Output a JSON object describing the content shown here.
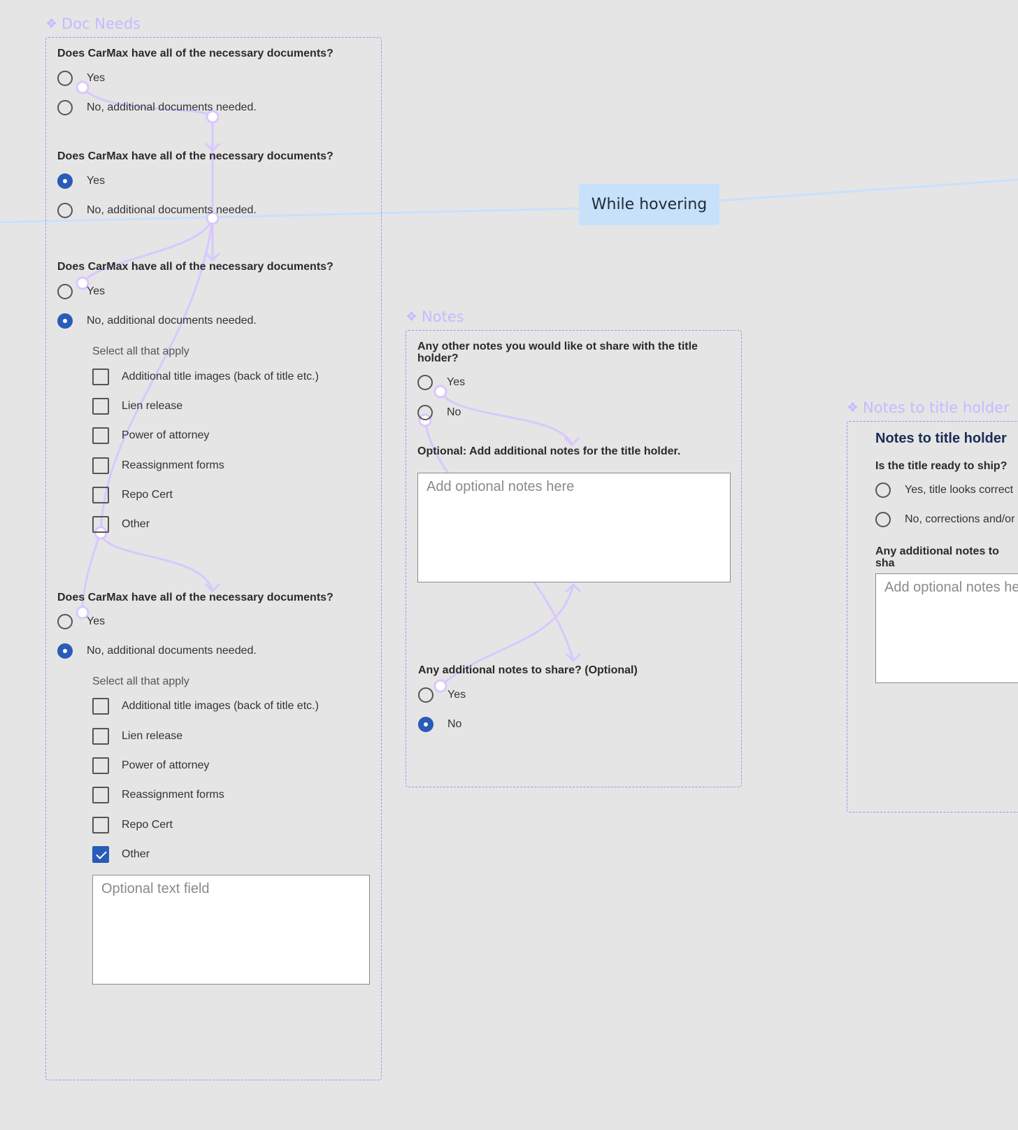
{
  "frames": {
    "doc_needs": {
      "label": "Doc Needs"
    },
    "notes": {
      "label": "Notes"
    },
    "notes_title_holder": {
      "label": "Notes to title holder"
    }
  },
  "hover_tag": "While hovering",
  "doc_needs": {
    "question": "Does CarMax have all of the necessary documents?",
    "yes": "Yes",
    "no": "No, additional documents needed.",
    "select_all": "Select all that apply",
    "checklist": [
      "Additional title images (back of title etc.)",
      "Lien release",
      "Power of attorney",
      "Reassignment forms",
      "Repo Cert",
      "Other"
    ],
    "optional_placeholder": "Optional text field"
  },
  "notes": {
    "q1": "Any other notes you would like ot share with the title holder?",
    "yes": "Yes",
    "no": "No",
    "q2": "Optional: Add additional notes for the title holder.",
    "placeholder": "Add optional notes here",
    "q3": "Any additional notes to share? (Optional)"
  },
  "title_holder": {
    "heading": "Notes to title holder",
    "q1": "Is the title ready to ship?",
    "opt_yes": "Yes, title looks correct",
    "opt_no": "No, corrections and/or",
    "q2": "Any additional notes to sha",
    "placeholder": "Add optional notes he"
  },
  "colors": {
    "accent": "#2a5bb8",
    "frame_border": "#a98bf0",
    "frame_label": "#c9b8ff",
    "hover_tag_bg": "#c7e1fb",
    "connector": "#d8c8ff"
  }
}
